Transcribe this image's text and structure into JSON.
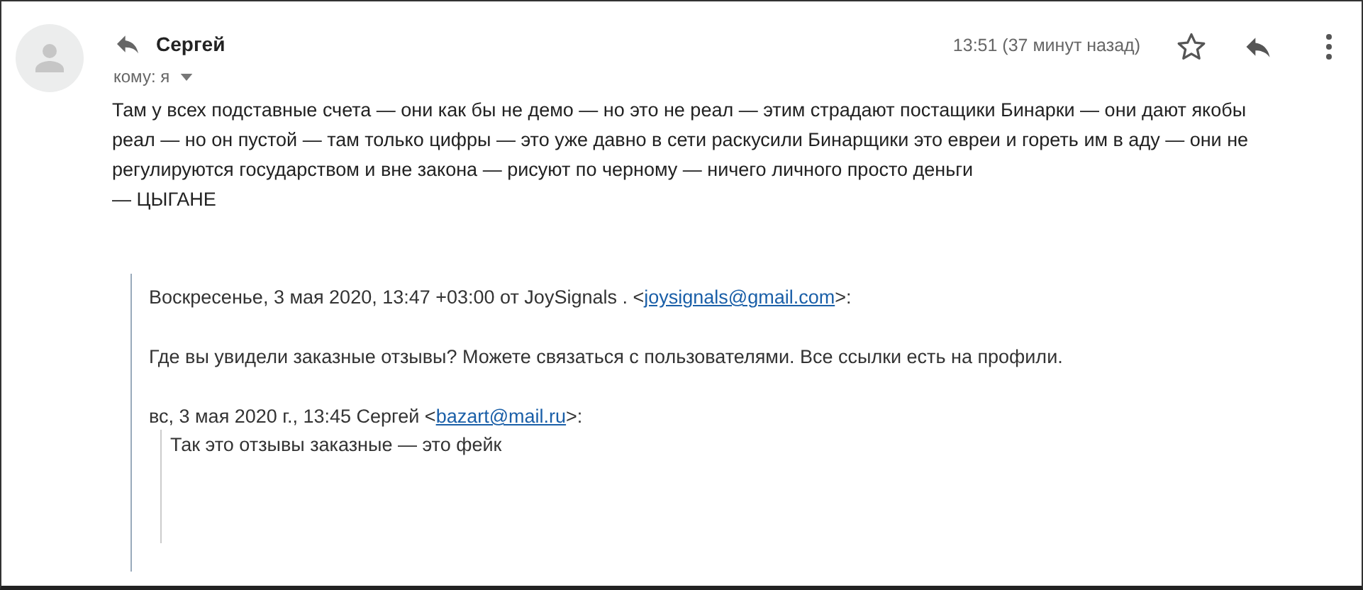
{
  "message": {
    "sender": "Сергей",
    "recipient": "кому: я",
    "time": "13:51 (37 минут назад)",
    "starred": false,
    "body": [
      "Там у всех подставные счета — они как бы не демо — но это не реал — этим страдают постащики Бинарки — они дают якобы реал — но он пустой — там только цифры — это уже давно в сети раскусили Бинарщики это евреи и гореть им в аду — они не регулируются государством и вне закона — рисуют по черному — ничего личного просто деньги",
      "— ЦЫГАНЕ"
    ]
  },
  "quote": {
    "header": {
      "before": "Воскресенье, 3 мая 2020, 13:47 +03:00 от JoySignals . <",
      "email": "joysignals@gmail.com",
      "after": ">:"
    },
    "text": "Где вы увидели заказные отзывы? Можете связаться с пользователями. Все ссылки есть на профили.",
    "inner": {
      "header": {
        "before": "вс, 3 мая 2020 г., 13:45 Сергей <",
        "email": "bazart@mail.ru",
        "after": ">:"
      },
      "text": "Так это отзывы заказные — это фейк"
    }
  }
}
